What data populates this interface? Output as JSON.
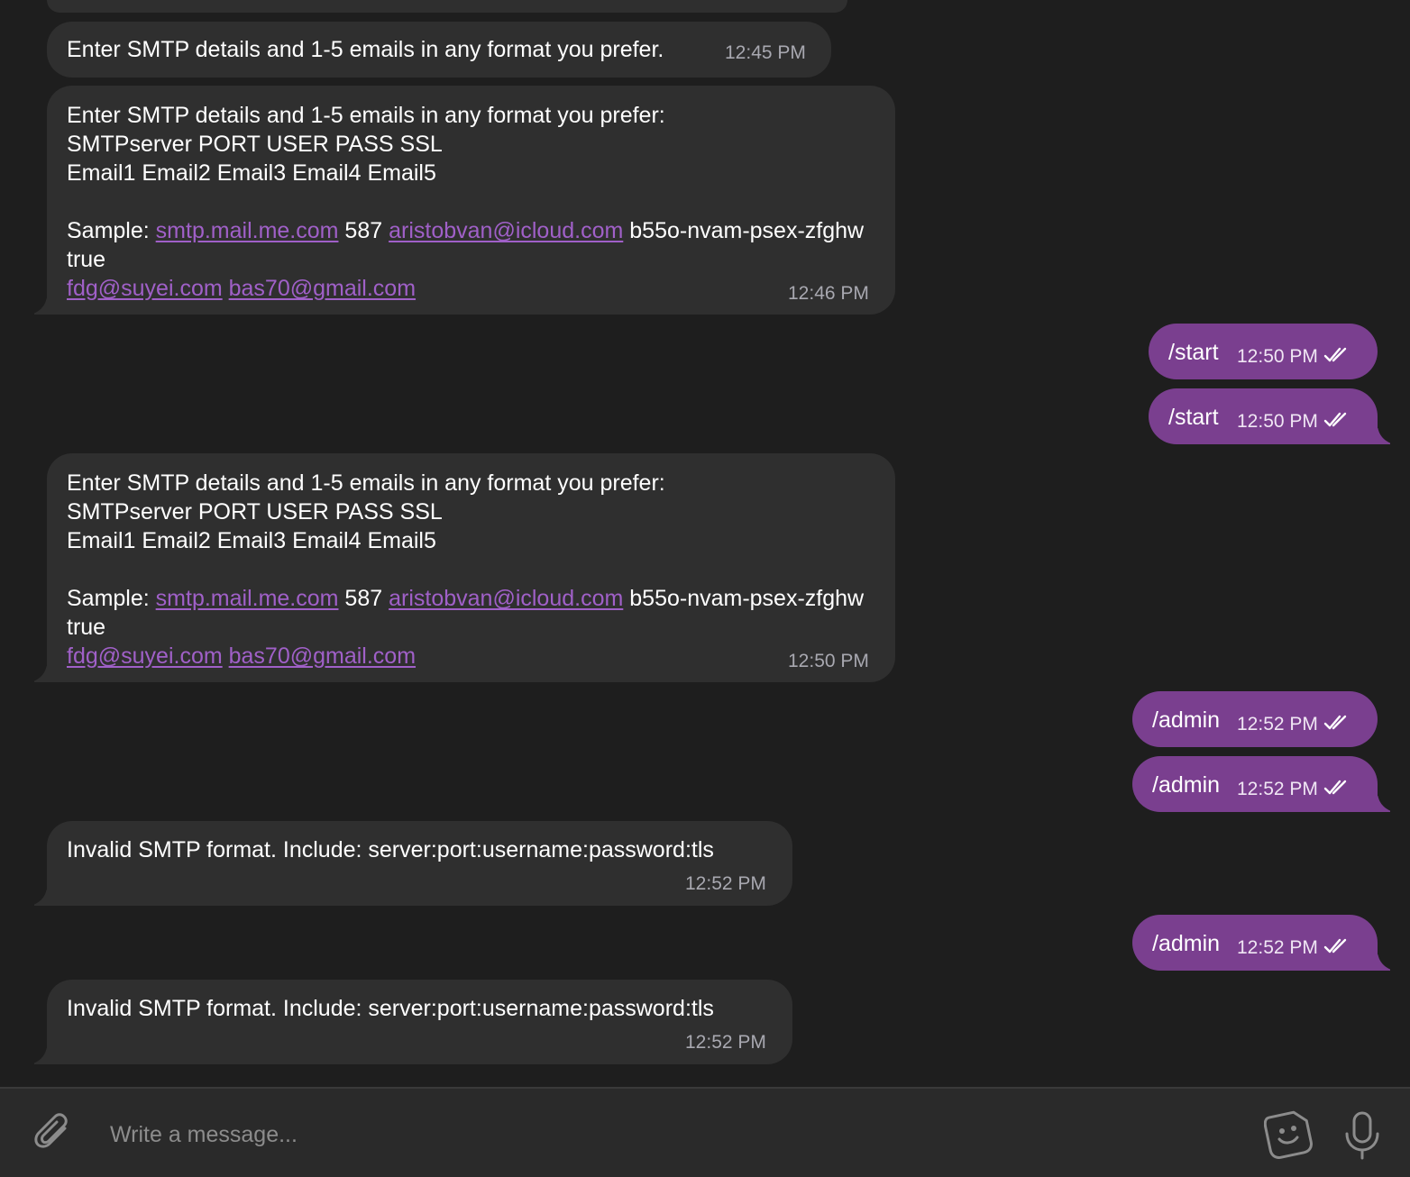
{
  "messages": [
    {
      "time": "12:45 PM",
      "text": "Enter SMTP details and 1-5 emails in any format you prefer."
    },
    {
      "time": "12:46 PM",
      "header": "Enter SMTP details and 1-5 emails in any format you prefer:\nSMTPserver PORT USER PASS SSL\nEmail1 Email2 Email3 Email4 Email5",
      "sample_label": "Sample: ",
      "link_server": "smtp.mail.me.com",
      "port": " 587 ",
      "link_user": "aristobvan@icloud.com",
      "pass": " b55o-nvam-psex-zfghw true",
      "link_email1": "fdg@suyei.com",
      "link_email2": "bas70@gmail.com"
    },
    {
      "time": "12:50 PM",
      "text": "/start"
    },
    {
      "time": "12:50 PM",
      "text": "/start"
    },
    {
      "time": "12:50 PM",
      "header": "Enter SMTP details and 1-5 emails in any format you prefer:\nSMTPserver PORT USER PASS SSL\nEmail1 Email2 Email3 Email4 Email5",
      "sample_label": "Sample: ",
      "link_server": "smtp.mail.me.com",
      "port": " 587 ",
      "link_user": "aristobvan@icloud.com",
      "pass": " b55o-nvam-psex-zfghw true",
      "link_email1": "fdg@suyei.com",
      "link_email2": "bas70@gmail.com"
    },
    {
      "time": "12:52 PM",
      "text": "/admin"
    },
    {
      "time": "12:52 PM",
      "text": "/admin"
    },
    {
      "time": "12:52 PM",
      "text": "Invalid SMTP format. Include: server:port:username:password:tls"
    },
    {
      "time": "12:52 PM",
      "text": "/admin"
    },
    {
      "time": "12:52 PM",
      "text": "Invalid SMTP format. Include: server:port:username:password:tls"
    }
  ],
  "composer": {
    "placeholder": "Write a message...",
    "icons": [
      "paperclip-icon",
      "sticker-icon",
      "microphone-icon"
    ]
  },
  "colors": {
    "background": "#1e1e1e",
    "incoming_bubble": "#2f2f2f",
    "outgoing_bubble": "#7a3f8f",
    "link": "#a060c8"
  }
}
